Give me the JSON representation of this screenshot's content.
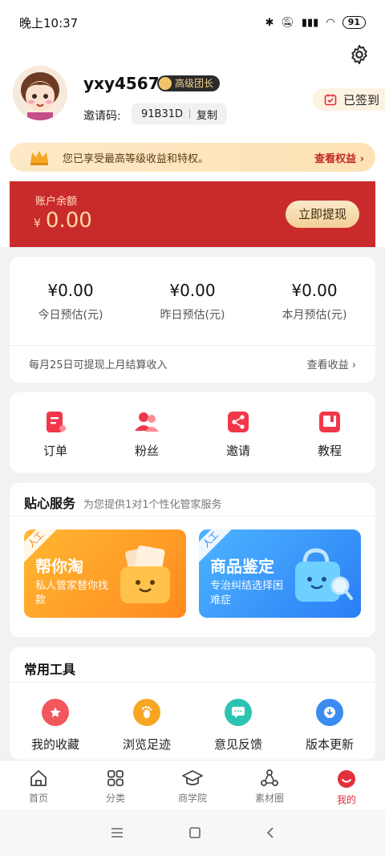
{
  "status": {
    "time": "晚上10:37",
    "battery": "91"
  },
  "profile": {
    "username": "yxy4567",
    "level": "高级团长",
    "invite_label": "邀请码:",
    "invite_code": "91B31D",
    "copy_label": "复制",
    "signin_label": "已签到"
  },
  "vip": {
    "text": "您已享受最高等级收益和特权。",
    "link": "查看权益"
  },
  "balance": {
    "label": "账户余额",
    "currency": "¥",
    "amount": "0.00",
    "withdraw": "立即提现"
  },
  "estimates": {
    "items": [
      {
        "value": "¥0.00",
        "label": "今日预估(元)"
      },
      {
        "value": "¥0.00",
        "label": "昨日预估(元)"
      },
      {
        "value": "¥0.00",
        "label": "本月预估(元)"
      }
    ],
    "note": "每月25日可提现上月结算收入",
    "link": "查看收益"
  },
  "quick": [
    {
      "label": "订单",
      "icon": "order-icon"
    },
    {
      "label": "粉丝",
      "icon": "fans-icon"
    },
    {
      "label": "邀请",
      "icon": "share-icon"
    },
    {
      "label": "教程",
      "icon": "tutorial-icon"
    }
  ],
  "service": {
    "title": "贴心服务",
    "subtitle": "为您提供1对1个性化管家服务",
    "cards": [
      {
        "tag": "人工",
        "title": "帮你淘",
        "desc": "私人管家替你找款"
      },
      {
        "tag": "人工",
        "title": "商品鉴定",
        "desc": "专治纠结选择困难症"
      }
    ]
  },
  "tools": {
    "title": "常用工具",
    "items": [
      {
        "label": "我的收藏",
        "icon": "star-icon",
        "color": "#f2575d"
      },
      {
        "label": "浏览足迹",
        "icon": "footprint-icon",
        "color": "#f7a623"
      },
      {
        "label": "意见反馈",
        "icon": "feedback-icon",
        "color": "#2bc4b0"
      },
      {
        "label": "版本更新",
        "icon": "download-icon",
        "color": "#3a8cf0"
      }
    ]
  },
  "tabs": [
    {
      "label": "首页",
      "icon": "home-icon"
    },
    {
      "label": "分类",
      "icon": "grid-icon"
    },
    {
      "label": "商学院",
      "icon": "graduation-cap-icon"
    },
    {
      "label": "素材圈",
      "icon": "share-circle-icon"
    },
    {
      "label": "我的",
      "icon": "smile-icon",
      "active": true
    }
  ],
  "colors": {
    "accent": "#c92b2c",
    "active_tab": "#e0303a",
    "gold": "#f5d48c"
  }
}
